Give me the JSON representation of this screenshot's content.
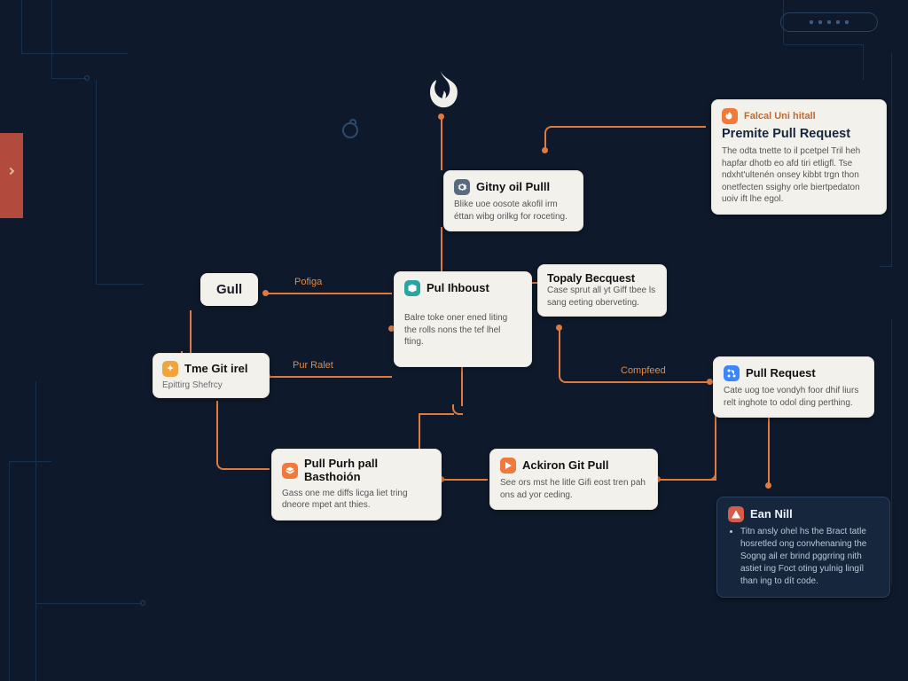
{
  "logo_name": "flame-logo",
  "edges": {
    "pofiga": "Pofiga",
    "pur_ralet": "Pur Ralet",
    "compfeed": "Compfeed"
  },
  "nodes": {
    "gull": {
      "title": "Gull"
    },
    "tme_git": {
      "title": "Tme Git irel",
      "sub": "Epittirg Shefrcy"
    },
    "gitny_pull": {
      "title": "Gitny oil Pulll",
      "desc": "Blike uoe oosote akofil irm éttan wibg orilkg for roceting."
    },
    "pul_ihboust": {
      "title": "Pul Ihboust",
      "desc": "Balre toke oner ened liting the rolls nons the tef lhel fting."
    },
    "topaly": {
      "title": "Topaly Becquest",
      "desc": "Case sprut all yt Giff tbee ls sang eeting oberveting."
    },
    "pull_basthoion": {
      "title": "Pull Purh pall Basthoión",
      "desc": "Gass one me diffs licga liet tring dneore mpet ant thies."
    },
    "ackron": {
      "title": "Ackiron Git Pull",
      "desc": "See ors mst he litle Gifi eost tren pah ons ad yor ceding."
    },
    "pull_request": {
      "title": "Pull Request",
      "desc": "Cate uog toe vondyh foor dhif liurs relt inghote to odol ding perthing."
    },
    "falcal": {
      "kicker": "Falcal Uni hitall",
      "title": "Premite Pull Request",
      "desc": "The odta tnette to il pcetpel Tril heh hapfar dhotb eo afd tiri etligfl. Tse ndxht'ultenén onsey kibbt trgn thon onetfecten ssighy orle biertpedaton uoiv ift lhe egol."
    },
    "ean_nill": {
      "title": "Ean Nill",
      "bullet": "Titn ansly ohel hs the Bract tatle hosretled ong convhenaning the Sogng ail er brind pggrring nith astiet ing Foct oting yulnig lingíl than ing to dít code."
    }
  }
}
